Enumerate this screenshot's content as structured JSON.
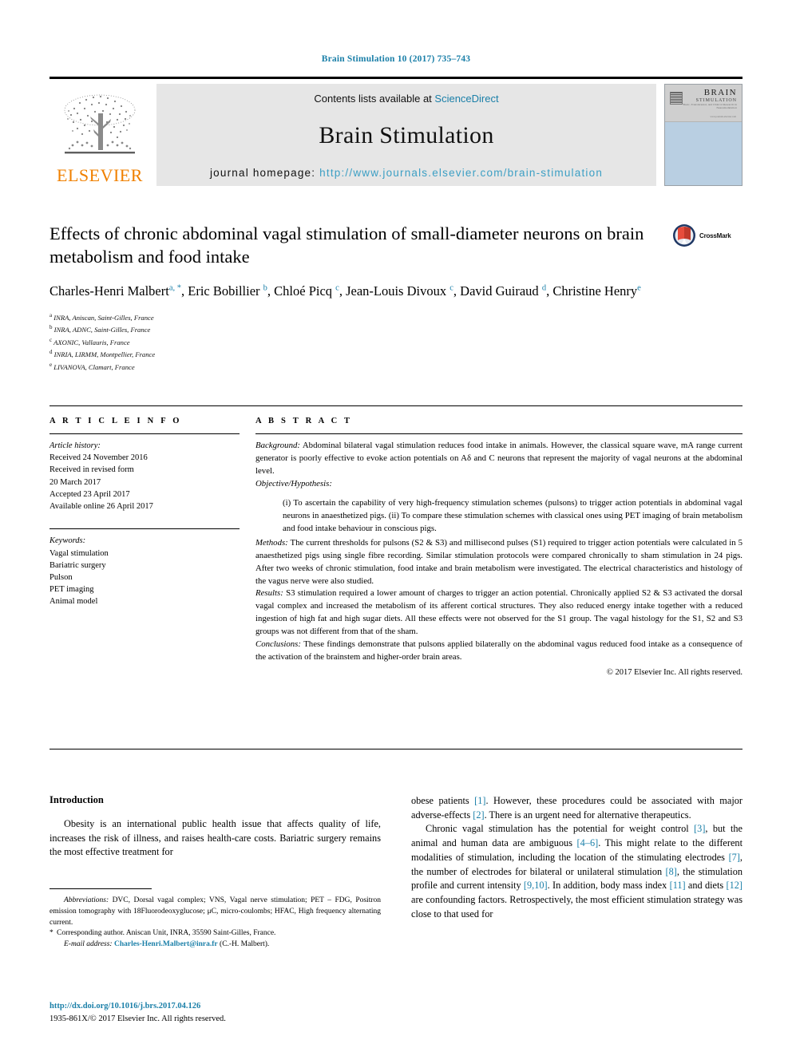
{
  "running_head": "Brain Stimulation 10 (2017) 735–743",
  "masthead": {
    "contents_prefix": "Contents lists available at ",
    "sciencedirect": "ScienceDirect",
    "journal_name": "Brain Stimulation",
    "homepage_prefix": "journal homepage: ",
    "homepage_url": "http://www.journals.elsevier.com/brain-stimulation",
    "publisher": "ELSEVIER",
    "cover": {
      "line1": "BRAIN",
      "line2": "STIMULATION",
      "line3": "Basic, Translational, and Clinical Research in Neuromodulation",
      "line4": "www.journals.elsevier.com"
    }
  },
  "article": {
    "title": "Effects of chronic abdominal vagal stimulation of small-diameter neurons on brain metabolism and food intake",
    "crossmark_label": "CrossMark",
    "authors_line1": "Charles-Henri Malbert",
    "authors": [
      {
        "name": "Charles-Henri Malbert",
        "marks": "a, *"
      },
      {
        "name": "Eric Bobillier",
        "marks": "b"
      },
      {
        "name": "Chloé Picq",
        "marks": "c"
      },
      {
        "name": "Jean-Louis Divoux",
        "marks": "c"
      },
      {
        "name": "David Guiraud",
        "marks": "d"
      },
      {
        "name": "Christine Henry",
        "marks": "e"
      }
    ],
    "affiliations": [
      {
        "mark": "a",
        "text": "INRA, Aniscan, Saint-Gilles, France"
      },
      {
        "mark": "b",
        "text": "INRA, ADNC, Saint-Gilles, France"
      },
      {
        "mark": "c",
        "text": "AXONIC, Vallauris, France"
      },
      {
        "mark": "d",
        "text": "INRIA, LIRMM, Montpellier, France"
      },
      {
        "mark": "e",
        "text": "LIVANOVA, Clamart, France"
      }
    ]
  },
  "article_info": {
    "heading": "A R T I C L E   I N F O",
    "history_label": "Article history:",
    "history": [
      "Received 24 November 2016",
      "Received in revised form",
      "20 March 2017",
      "Accepted 23 April 2017",
      "Available online 26 April 2017"
    ],
    "keywords_label": "Keywords:",
    "keywords": [
      "Vagal stimulation",
      "Bariatric surgery",
      "Pulson",
      "PET imaging",
      "Animal model"
    ]
  },
  "abstract": {
    "heading": "A B S T R A C T",
    "background_label": "Background:",
    "background_text": " Abdominal bilateral vagal stimulation reduces food intake in animals. However, the classical square wave, mA range current generator is poorly effective to evoke action potentials on Aδ and C neurons that represent the majority of vagal neurons at the abdominal level.",
    "objective_label": "Objective/Hypothesis:",
    "objective_items": [
      "(i) To ascertain the capability of very high-frequency stimulation schemes (pulsons) to trigger action potentials in abdominal vagal neurons in anaesthetized pigs. (ii) To compare these stimulation schemes with classical ones using PET imaging of brain metabolism and food intake behaviour in conscious pigs."
    ],
    "methods_label": "Methods:",
    "methods_text": " The current thresholds for pulsons (S2 & S3) and millisecond pulses (S1) required to trigger action potentials were calculated in 5 anaesthetized pigs using single fibre recording. Similar stimulation protocols were compared chronically to sham stimulation in 24 pigs. After two weeks of chronic stimulation, food intake and brain metabolism were investigated. The electrical characteristics and histology of the vagus nerve were also studied.",
    "results_label": "Results:",
    "results_text": " S3 stimulation required a lower amount of charges to trigger an action potential. Chronically applied S2 & S3 activated the dorsal vagal complex and increased the metabolism of its afferent cortical structures. They also reduced energy intake together with a reduced ingestion of high fat and high sugar diets. All these effects were not observed for the S1 group. The vagal histology for the S1, S2 and S3 groups was not different from that of the sham.",
    "conclusions_label": "Conclusions:",
    "conclusions_text": " These findings demonstrate that pulsons applied bilaterally on the abdominal vagus reduced food intake as a consequence of the activation of the brainstem and higher-order brain areas.",
    "copyright": "© 2017 Elsevier Inc. All rights reserved."
  },
  "introduction": {
    "heading": "Introduction",
    "left_paragraph": "Obesity is an international public health issue that affects quality of life, increases the risk of illness, and raises health-care costs. Bariatric surgery remains the most effective treatment for",
    "right_p1_a": "obese patients ",
    "right_p1_ref1": "[1]",
    "right_p1_b": ". However, these procedures could be associated with major adverse-effects ",
    "right_p1_ref2": "[2]",
    "right_p1_c": ". There is an urgent need for alternative therapeutics.",
    "right_p2_a": "Chronic vagal stimulation has the potential for weight control ",
    "right_p2_ref3": "[3]",
    "right_p2_b": ", but the animal and human data are ambiguous ",
    "right_p2_ref4": "[4–6]",
    "right_p2_c": ". This might relate to the different modalities of stimulation, including the location of the stimulating electrodes ",
    "right_p2_ref7": "[7]",
    "right_p2_d": ", the number of electrodes for bilateral or unilateral stimulation ",
    "right_p2_ref8": "[8]",
    "right_p2_e": ", the stimulation profile and current intensity ",
    "right_p2_ref910": "[9,10]",
    "right_p2_f": ". In addition, body mass index ",
    "right_p2_ref11": "[11]",
    "right_p2_g": " and diets ",
    "right_p2_ref12": "[12]",
    "right_p2_h": " are confounding factors. Retrospectively, the most efficient stimulation strategy was close to that used for"
  },
  "footnotes": {
    "abbrev_label": "Abbreviations:",
    "abbrev_text": " DVC, Dorsal vagal complex; VNS, Vagal nerve stimulation; PET – FDG, Positron emission tomography with 18Fluorodeoxyglucose; μC, micro-coulombs; HFAC, High frequency alternating current.",
    "corresponding_star": "*",
    "corresponding_text": "Corresponding author. Aniscan Unit, INRA, 35590 Saint-Gilles, France.",
    "email_label": "E-mail address:",
    "email": "Charles-Henri.Malbert@inra.fr",
    "email_suffix": " (C.-H. Malbert).",
    "doi": "http://dx.doi.org/10.1016/j.brs.2017.04.126",
    "issn_line": "1935-861X/© 2017 Elsevier Inc. All rights reserved."
  },
  "colors": {
    "link": "#1a7fa8",
    "elsevier_orange": "#F08000",
    "band_gray": "#e6e6e6",
    "cover_blue": "#b9cfe2"
  }
}
